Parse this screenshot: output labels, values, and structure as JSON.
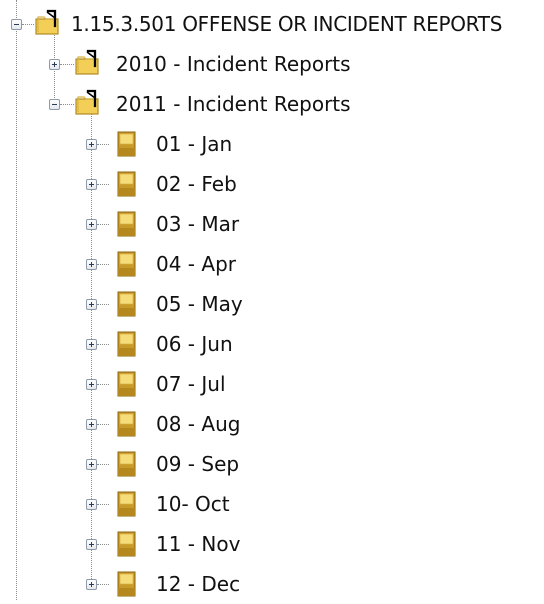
{
  "tree": {
    "root": {
      "label": "1.15.3.501 OFFENSE OR INCIDENT REPORTS",
      "icon": "folder-open-icon",
      "expanded": true
    },
    "years": [
      {
        "label": "2010 - Incident Reports",
        "icon": "folder-open-icon",
        "expanded": false
      },
      {
        "label": "2011 - Incident Reports",
        "icon": "folder-open-icon",
        "expanded": true
      }
    ],
    "months": [
      {
        "label": "01 - Jan",
        "icon": "folder-tab-icon",
        "expanded": false
      },
      {
        "label": "02 - Feb",
        "icon": "folder-tab-icon",
        "expanded": false
      },
      {
        "label": "03 - Mar",
        "icon": "folder-tab-icon",
        "expanded": false
      },
      {
        "label": "04 - Apr",
        "icon": "folder-tab-icon",
        "expanded": false
      },
      {
        "label": "05 - May",
        "icon": "folder-tab-icon",
        "expanded": false
      },
      {
        "label": "06 - Jun",
        "icon": "folder-tab-icon",
        "expanded": false
      },
      {
        "label": "07 - Jul",
        "icon": "folder-tab-icon",
        "expanded": false
      },
      {
        "label": "08 - Aug",
        "icon": "folder-tab-icon",
        "expanded": false
      },
      {
        "label": "09 - Sep",
        "icon": "folder-tab-icon",
        "expanded": false
      },
      {
        "label": "10- Oct",
        "icon": "folder-tab-icon",
        "expanded": false
      },
      {
        "label": "11 - Nov",
        "icon": "folder-tab-icon",
        "expanded": false
      },
      {
        "label": "12 - Dec",
        "icon": "folder-tab-icon",
        "expanded": false
      }
    ]
  },
  "colors": {
    "folder_yellow": "#f5d35a",
    "folder_gold": "#c89a28",
    "folder_dark": "#000000"
  }
}
